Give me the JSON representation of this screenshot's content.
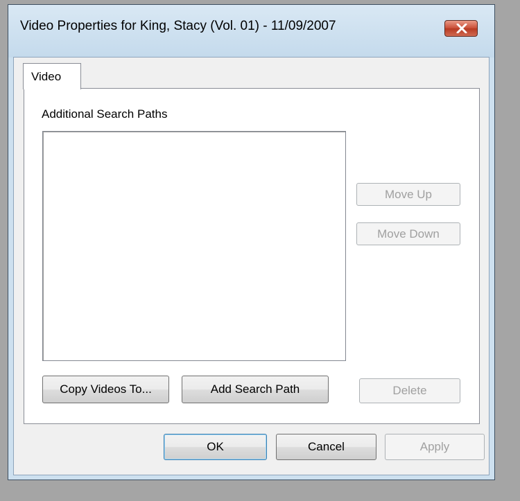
{
  "window": {
    "title": "Video Properties for King, Stacy (Vol. 01) - 11/09/2007",
    "close_icon": "close-icon"
  },
  "tabs": [
    {
      "label": "Video",
      "selected": true
    }
  ],
  "video_tab": {
    "paths_label": "Additional Search Paths",
    "search_paths": [],
    "move_up_label": "Move Up",
    "move_down_label": "Move Down",
    "copy_videos_label": "Copy Videos To...",
    "add_path_label": "Add Search Path",
    "delete_label": "Delete"
  },
  "footer": {
    "ok_label": "OK",
    "cancel_label": "Cancel",
    "apply_label": "Apply"
  },
  "colors": {
    "title_bar": "#cde0ef",
    "close_button": "#c84c35",
    "disabled_text": "#a0a0a0"
  }
}
